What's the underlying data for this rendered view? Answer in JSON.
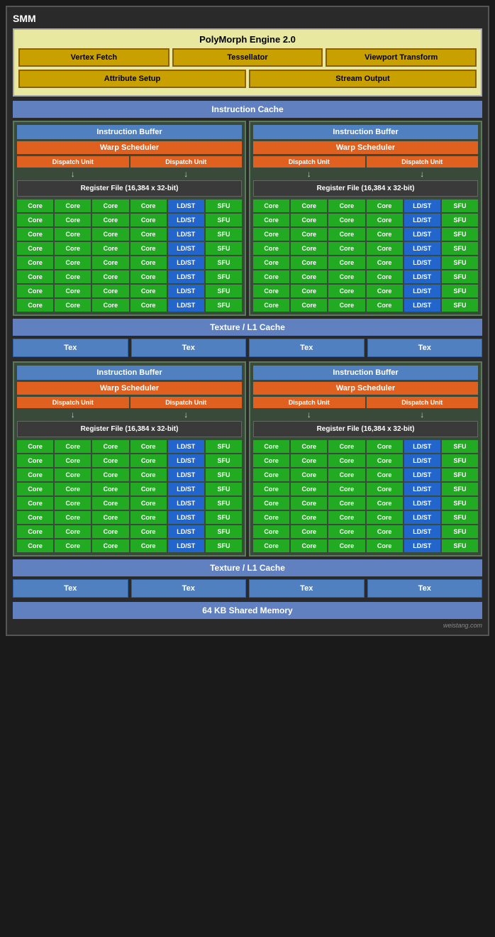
{
  "title": "SMM",
  "polymorph": {
    "title": "PolyMorph Engine 2.0",
    "row1": [
      "Vertex Fetch",
      "Tessellator",
      "Viewport Transform"
    ],
    "row2": [
      "Attribute Setup",
      "Stream Output"
    ]
  },
  "instruction_cache": "Instruction Cache",
  "sm_blocks": [
    {
      "id": "top",
      "columns": [
        {
          "instruction_buffer": "Instruction Buffer",
          "warp_scheduler": "Warp Scheduler",
          "dispatch_units": [
            "Dispatch Unit",
            "Dispatch Unit"
          ],
          "register_file": "Register File (16,384 x 32-bit)",
          "rows": 8,
          "row_content": [
            "Core",
            "Core",
            "Core",
            "Core",
            "LD/ST",
            "SFU"
          ]
        },
        {
          "instruction_buffer": "Instruction Buffer",
          "warp_scheduler": "Warp Scheduler",
          "dispatch_units": [
            "Dispatch Unit",
            "Dispatch Unit"
          ],
          "register_file": "Register File (16,384 x 32-bit)",
          "rows": 8,
          "row_content": [
            "Core",
            "Core",
            "Core",
            "Core",
            "LD/ST",
            "SFU"
          ]
        }
      ]
    },
    {
      "id": "bottom",
      "columns": [
        {
          "instruction_buffer": "Instruction Buffer",
          "warp_scheduler": "Warp Scheduler",
          "dispatch_units": [
            "Dispatch Unit",
            "Dispatch Unit"
          ],
          "register_file": "Register File (16,384 x 32-bit)",
          "rows": 8,
          "row_content": [
            "Core",
            "Core",
            "Core",
            "Core",
            "LD/ST",
            "SFU"
          ]
        },
        {
          "instruction_buffer": "Instruction Buffer",
          "warp_scheduler": "Warp Scheduler",
          "dispatch_units": [
            "Dispatch Unit",
            "Dispatch Unit"
          ],
          "register_file": "Register File (16,384 x 32-bit)",
          "rows": 8,
          "row_content": [
            "Core",
            "Core",
            "Core",
            "Core",
            "LD/ST",
            "SFU"
          ]
        }
      ]
    }
  ],
  "texture_cache": "Texture / L1 Cache",
  "tex_units": [
    "Tex",
    "Tex",
    "Tex",
    "Tex"
  ],
  "shared_memory": "64 KB Shared Memory",
  "watermark": "weistang.com"
}
